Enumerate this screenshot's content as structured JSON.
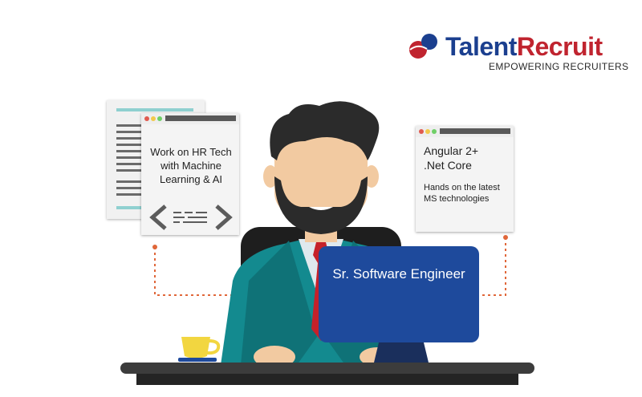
{
  "brand": {
    "name_part1": "Talent",
    "name_part2": "Recruit",
    "tagline": "EMPOWERING RECRUITERS",
    "colors": {
      "blue": "#1b3f8f",
      "red": "#c0242f"
    }
  },
  "left_card": {
    "line1": "Work on HR Tech",
    "line2": "with Machine",
    "line3": "Learning & AI"
  },
  "right_card": {
    "title1": "Angular 2+",
    "title2": ".Net Core",
    "sub1": "Hands on the latest",
    "sub2": "MS technologies"
  },
  "monitor": {
    "label": "Sr. Software Engineer"
  },
  "icons": [
    "logo-mark",
    "code-brackets-icon",
    "coffee-cup-icon"
  ],
  "colors": {
    "monitor": "#1e4a9c",
    "suit": "#138a8f",
    "connector": "#e0673a",
    "cup": "#f2d640",
    "desk": "#3c3c3c"
  }
}
